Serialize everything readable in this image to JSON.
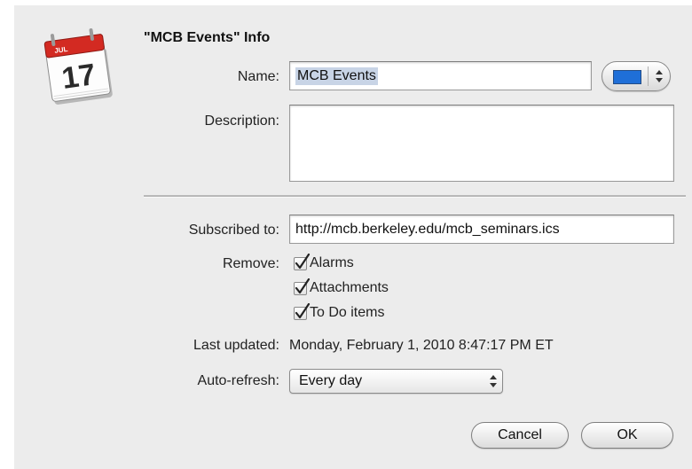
{
  "dialog": {
    "title": "\"MCB Events\" Info",
    "calendar_icon": {
      "month": "JUL",
      "day": "17"
    }
  },
  "name": {
    "label": "Name:",
    "value": "MCB Events",
    "color": "#1f6fd8"
  },
  "description": {
    "label": "Description:",
    "value": ""
  },
  "subscription": {
    "label": "Subscribed to:",
    "url": "http://mcb.berkeley.edu/mcb_seminars.ics"
  },
  "remove": {
    "label": "Remove:",
    "options": [
      {
        "label": "Alarms",
        "checked": true
      },
      {
        "label": "Attachments",
        "checked": true
      },
      {
        "label": "To Do items",
        "checked": true
      }
    ]
  },
  "last_updated": {
    "label": "Last updated:",
    "value": "Monday, February 1, 2010 8:47:17 PM ET"
  },
  "auto_refresh": {
    "label": "Auto-refresh:",
    "value": "Every day"
  },
  "buttons": {
    "cancel": "Cancel",
    "ok": "OK"
  }
}
